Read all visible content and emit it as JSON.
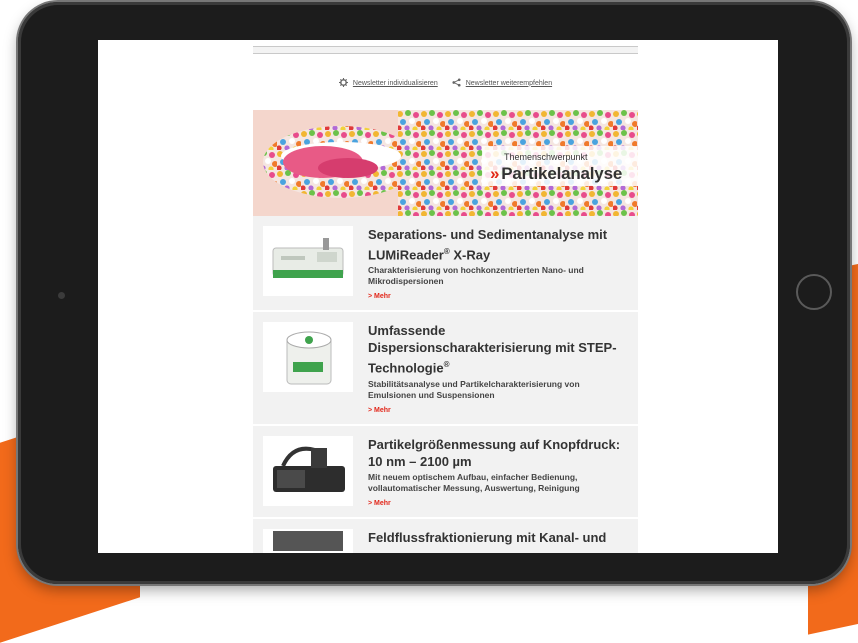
{
  "toolbar": {
    "customize_label": "Newsletter individualisieren",
    "share_label": "Newsletter weiterempfehlen"
  },
  "banner": {
    "subtitle": "Themenschwerpunkt",
    "chevron": "»",
    "title": "Partikelanalyse"
  },
  "articles": [
    {
      "title": "Separations- und Sedimentanalyse mit LUMiReader",
      "title_sup": "®",
      "title_suffix": " X-Ray",
      "desc": "Charakterisierung von hochkonzentrierten Nano- und Mikrodispersionen",
      "more": "> Mehr"
    },
    {
      "title": "Umfassende Dispersionscharakterisierung mit STEP-Technologie",
      "title_sup": "®",
      "title_suffix": "",
      "desc": "Stabilitätsanalyse und Partikelcharakterisierung von Emulsionen und Suspensionen",
      "more": "> Mehr"
    },
    {
      "title": "Partikelgrößenmessung auf Knopfdruck: 10 nm – 2100 µm",
      "title_sup": "",
      "title_suffix": "",
      "desc": "Mit neuem optischem Aufbau, einfacher Bedienung, vollautomatischer Messung, Auswertung, Reinigung",
      "more": "> Mehr"
    },
    {
      "title": "Feldflussfraktionierung mit Kanal- und",
      "title_sup": "",
      "title_suffix": "",
      "desc": "",
      "more": ""
    }
  ],
  "colors": {
    "accent": "#e2271a",
    "brand_orange": "#f26a1b",
    "bezel": "#1c1c1c"
  },
  "icons": {
    "customize": "gear-icon",
    "share": "share-icon"
  }
}
